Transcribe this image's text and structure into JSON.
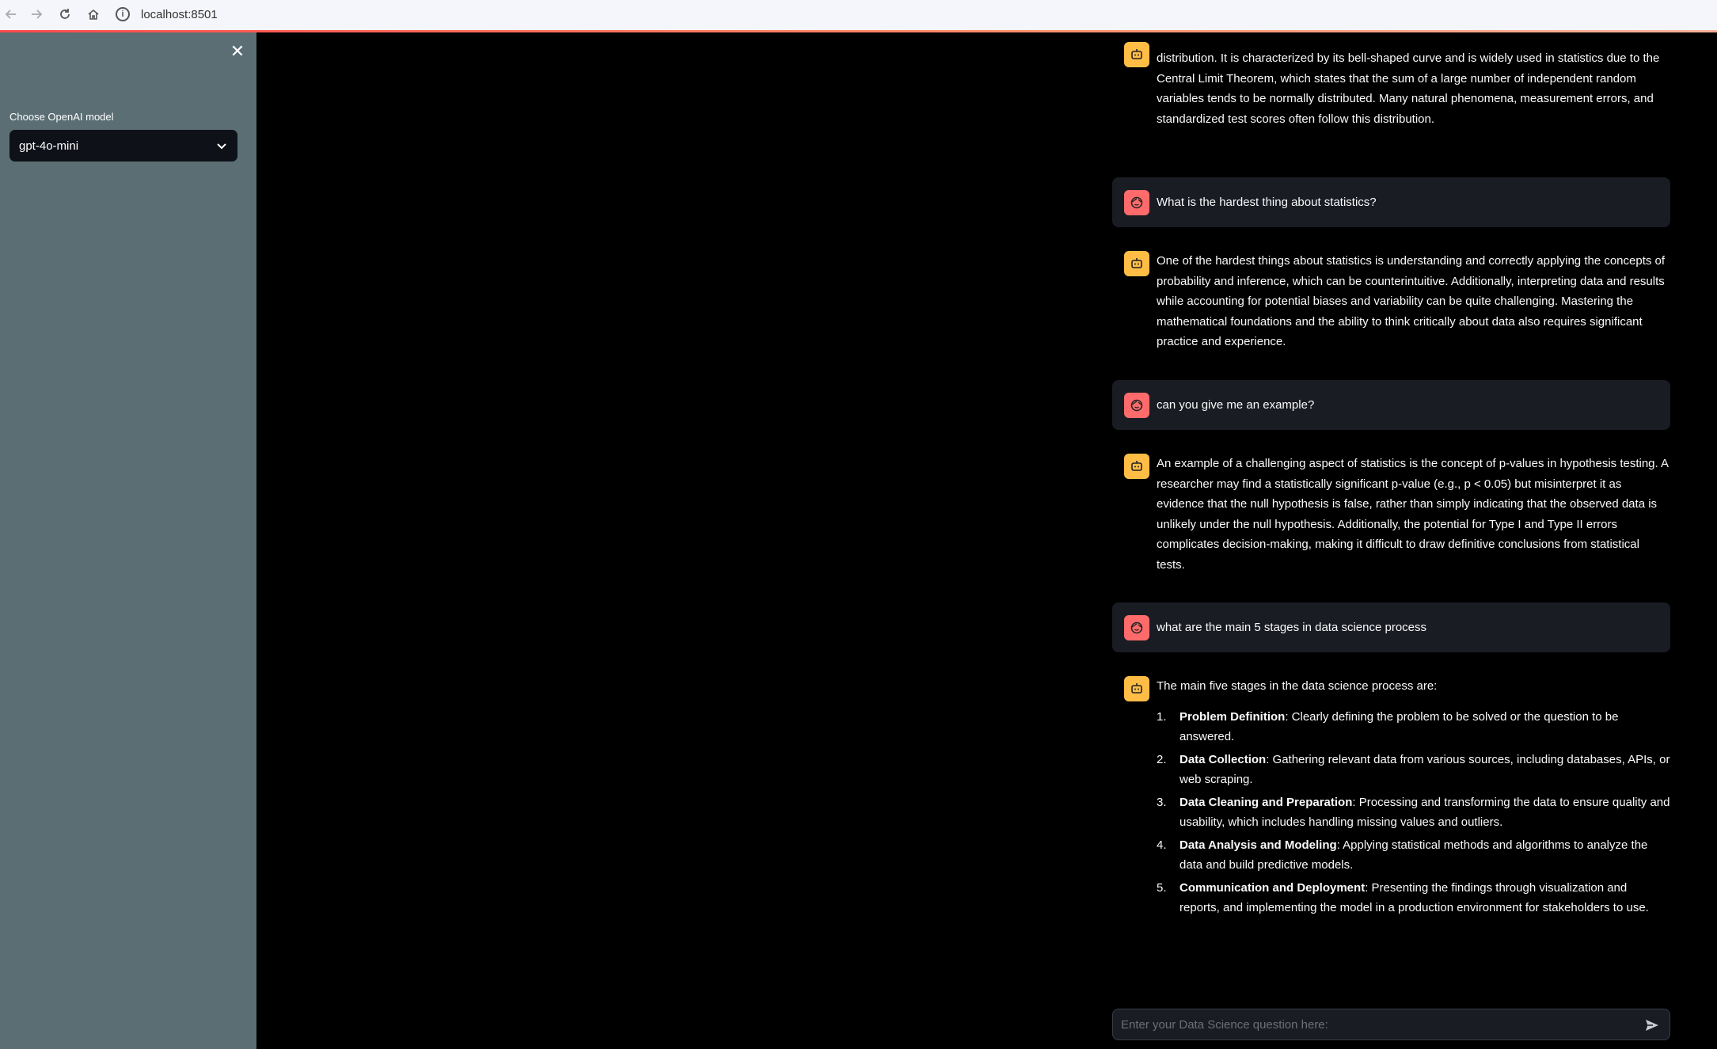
{
  "browser": {
    "url": "localhost:8501",
    "info_icon_glyph": "i"
  },
  "sidebar": {
    "close_glyph": "✕",
    "model_label": "Choose OpenAI model",
    "model_value": "gpt-4o-mini"
  },
  "chat": {
    "messages": [
      {
        "role": "assistant",
        "text": "distribution. It is characterized by its bell-shaped curve and is widely used in statistics due to the Central Limit Theorem, which states that the sum of a large number of independent random variables tends to be normally distributed. Many natural phenomena, measurement errors, and standardized test scores often follow this distribution."
      },
      {
        "role": "user",
        "text": "What is the hardest thing about statistics?"
      },
      {
        "role": "assistant",
        "text": "One of the hardest things about statistics is understanding and correctly applying the concepts of probability and inference, which can be counterintuitive. Additionally, interpreting data and results while accounting for potential biases and variability can be quite challenging. Mastering the mathematical foundations and the ability to think critically about data also requires significant practice and experience."
      },
      {
        "role": "user",
        "text": "can you give me an example?"
      },
      {
        "role": "assistant",
        "text": "An example of a challenging aspect of statistics is the concept of p-values in hypothesis testing. A researcher may find a statistically significant p-value (e.g., p < 0.05) but misinterpret it as evidence that the null hypothesis is false, rather than simply indicating that the observed data is unlikely under the null hypothesis. Additionally, the potential for Type I and Type II errors complicates decision-making, making it difficult to draw definitive conclusions from statistical tests."
      },
      {
        "role": "user",
        "text": "what are the main 5 stages in data science process"
      },
      {
        "role": "assistant",
        "intro": "The main five stages in the data science process are:",
        "stages": [
          {
            "title": "Problem Definition",
            "desc": ": Clearly defining the problem to be solved or the question to be answered."
          },
          {
            "title": "Data Collection",
            "desc": ": Gathering relevant data from various sources, including databases, APIs, or web scraping."
          },
          {
            "title": "Data Cleaning and Preparation",
            "desc": ": Processing and transforming the data to ensure quality and usability, which includes handling missing values and outliers."
          },
          {
            "title": "Data Analysis and Modeling",
            "desc": ": Applying statistical methods and algorithms to analyze the data and build predictive models."
          },
          {
            "title": "Communication and Deployment",
            "desc": ": Presenting the findings through visualization and reports, and implementing the model in a production environment for stakeholders to use."
          }
        ]
      }
    ],
    "input_placeholder": "Enter your Data Science question here:"
  },
  "colors": {
    "sidebar_bg": "#5a6e74",
    "main_bg": "#000000",
    "user_bubble": "#1a1c24",
    "user_avatar": "#ff6a6a",
    "assistant_avatar": "#ffbd45",
    "accent": "#ff4b4b"
  },
  "icons": {
    "back": "arrow-left-icon",
    "forward": "arrow-right-icon",
    "reload": "reload-icon",
    "home": "home-icon",
    "close": "close-icon",
    "dropdown": "chevron-down-icon",
    "user_avatar": "user-face-icon",
    "assistant_avatar": "robot-icon",
    "send": "send-icon"
  }
}
